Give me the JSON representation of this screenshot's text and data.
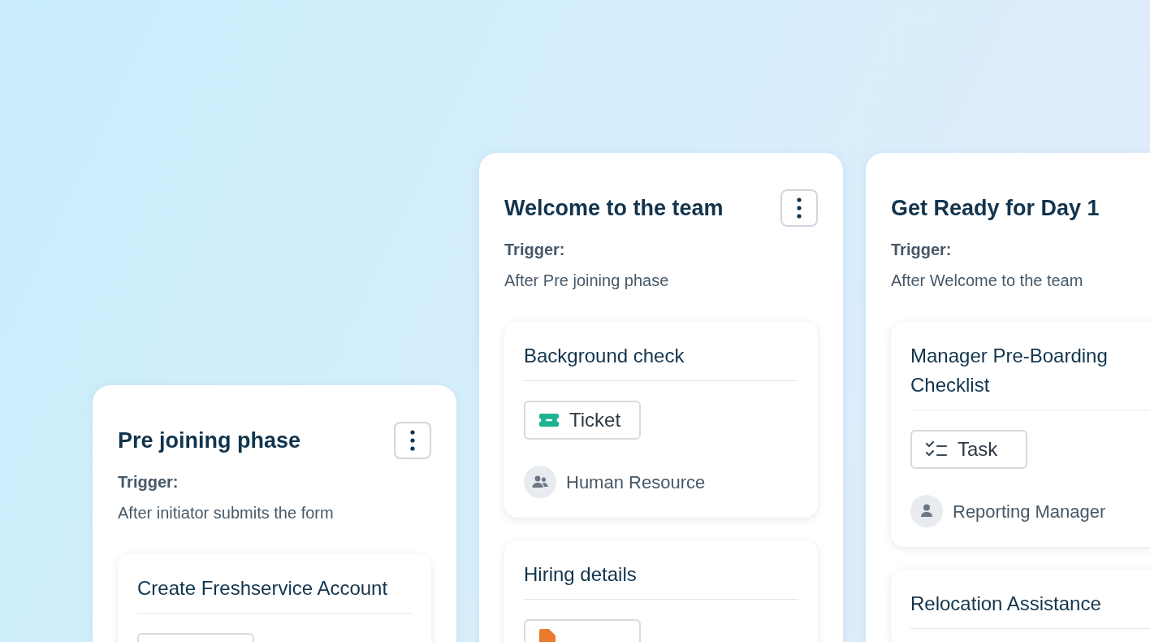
{
  "phases": [
    {
      "title": "Pre joining phase",
      "menu_button": true,
      "trigger_label": "Trigger:",
      "trigger_value": "After initiator submits the form",
      "tasks": [
        {
          "title": "Create Freshservice Account",
          "badge": {
            "kind": "blank"
          }
        }
      ]
    },
    {
      "title": "Welcome to the team",
      "menu_button": true,
      "trigger_label": "Trigger:",
      "trigger_value": "After Pre joining phase",
      "tasks": [
        {
          "title": "Background check",
          "badge": {
            "kind": "ticket",
            "label": "Ticket"
          },
          "assignee": {
            "kind": "group",
            "name": "Human Resource"
          }
        },
        {
          "title": "Hiring details",
          "badge": {
            "kind": "document"
          }
        }
      ]
    },
    {
      "title": "Get Ready for Day 1",
      "trigger_label": "Trigger:",
      "trigger_value": "After Welcome to the team",
      "tasks": [
        {
          "title": "Manager Pre-Boarding Checklist",
          "badge": {
            "kind": "task",
            "label": "Task"
          },
          "assignee": {
            "kind": "person",
            "name": "Reporting Manager"
          }
        },
        {
          "title": "Relocation Assistance"
        }
      ]
    }
  ]
}
